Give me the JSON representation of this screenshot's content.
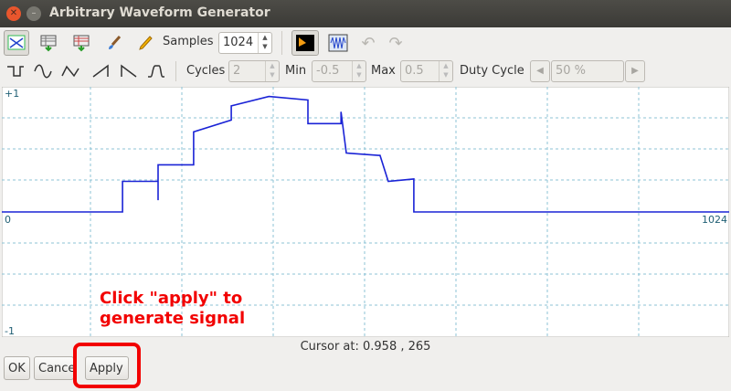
{
  "window": {
    "title": "Arbitrary Waveform Generator"
  },
  "toolbar": {
    "samples_label": "Samples",
    "samples_value": "1024",
    "cycles_label": "Cycles",
    "cycles_value": "2",
    "min_label": "Min",
    "min_value": "-0.5",
    "max_label": "Max",
    "max_value": "0.5",
    "duty_label": "Duty Cycle",
    "duty_value": "50 %"
  },
  "icons": [
    "waveform-view-icon",
    "load-file-icon",
    "save-file-icon",
    "brush-icon",
    "pencil-icon",
    "fill-color-icon",
    "waveform-preview-icon",
    "undo-icon",
    "redo-icon",
    "square-wave-icon",
    "sine-wave-icon",
    "triangle-wave-icon",
    "sawtooth-up-icon",
    "sawtooth-down-icon",
    "pulse-wave-icon"
  ],
  "plot": {
    "y_top_label": "+1",
    "y_bottom_label": "-1",
    "x_min_label": "0",
    "x_max_label": "1024",
    "x_range": [
      0,
      1024
    ],
    "y_range": [
      -1,
      1
    ],
    "colors": {
      "grid": "#8ec3d6",
      "trace": "#1a23d6",
      "axis_label": "#1f5f74"
    },
    "waveform": [
      [
        0,
        0
      ],
      [
        340,
        0
      ],
      [
        340,
        0.26
      ],
      [
        440,
        0.26
      ],
      [
        440,
        0.1
      ],
      [
        440,
        0.4
      ],
      [
        540,
        0.4
      ],
      [
        540,
        0.68
      ],
      [
        646,
        0.78
      ],
      [
        646,
        0.9
      ],
      [
        752,
        0.98
      ],
      [
        752,
        0.98
      ],
      [
        862,
        0.95
      ],
      [
        862,
        0.75
      ],
      [
        955,
        0.75
      ],
      [
        955,
        0.85
      ],
      [
        970,
        0.5
      ],
      [
        1060,
        0.48
      ],
      [
        1065,
        0.48
      ],
      [
        1088,
        0.26
      ],
      [
        1160,
        0.28
      ],
      [
        1160,
        0
      ],
      [
        2048,
        0
      ]
    ]
  },
  "status": {
    "cursor_text": "Cursor at: 0.958 , 265"
  },
  "buttons": {
    "ok": "OK",
    "cancel": "Cancel",
    "apply": "Apply"
  },
  "annotation": {
    "line1": "Click \"apply\" to",
    "line2": "generate signal",
    "color": "#f20000"
  }
}
